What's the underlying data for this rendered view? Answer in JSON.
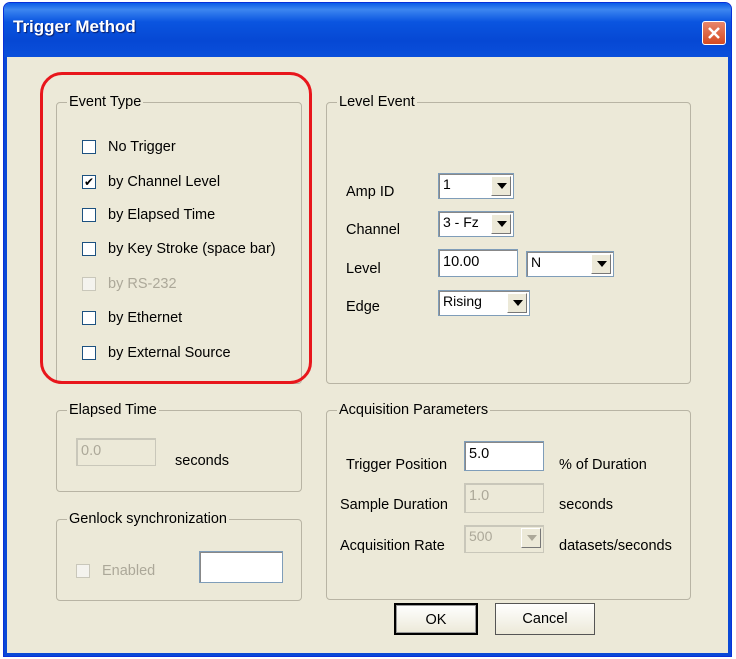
{
  "window": {
    "title": "Trigger Method"
  },
  "event_type": {
    "label": "Event Type",
    "options": [
      {
        "label": "No Trigger",
        "checked": false,
        "enabled": true
      },
      {
        "label": "by Channel Level",
        "checked": true,
        "enabled": true
      },
      {
        "label": "by Elapsed Time",
        "checked": false,
        "enabled": true
      },
      {
        "label": "by Key Stroke (space bar)",
        "checked": false,
        "enabled": true
      },
      {
        "label": "by RS-232",
        "checked": false,
        "enabled": false
      },
      {
        "label": "by Ethernet",
        "checked": false,
        "enabled": true
      },
      {
        "label": "by External Source",
        "checked": false,
        "enabled": true
      }
    ]
  },
  "level_event": {
    "label": "Level Event",
    "amp_id": {
      "label": "Amp ID",
      "value": "1"
    },
    "channel": {
      "label": "Channel",
      "value": "3 - Fz"
    },
    "level": {
      "label": "Level",
      "value": "10.00",
      "unit": "N"
    },
    "edge": {
      "label": "Edge",
      "value": "Rising"
    }
  },
  "elapsed_time": {
    "label": "Elapsed Time",
    "value": "0.0",
    "unit": "seconds"
  },
  "genlock": {
    "label": "Genlock synchronization",
    "enabled_label": "Enabled",
    "value": ""
  },
  "acquisition": {
    "label": "Acquisition Parameters",
    "trigger_position": {
      "label": "Trigger Position",
      "value": "5.0",
      "unit": "% of Duration"
    },
    "sample_duration": {
      "label": "Sample Duration",
      "value": "1.0",
      "unit": "seconds"
    },
    "acquisition_rate": {
      "label": "Acquisition Rate",
      "value": "500",
      "unit": "datasets/seconds"
    }
  },
  "buttons": {
    "ok": "OK",
    "cancel": "Cancel"
  },
  "colors": {
    "highlight": "#e8161c",
    "titlebar": "#0a55e0",
    "dialog_bg": "#ece9d8"
  }
}
